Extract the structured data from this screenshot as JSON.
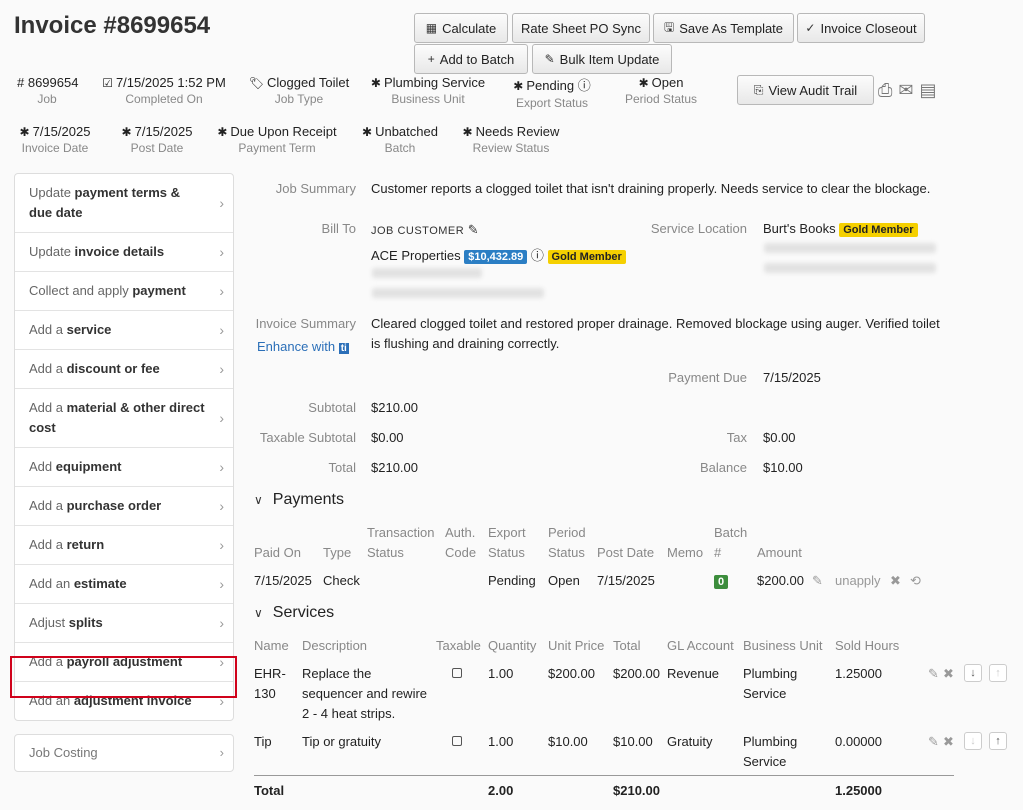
{
  "header": {
    "title": "Invoice #8699654"
  },
  "toolbar": {
    "calculate": "Calculate",
    "rate_sheet": "Rate Sheet PO Sync",
    "save_template": "Save As Template",
    "closeout": "Invoice Closeout",
    "add_batch": "Add to Batch",
    "bulk_update": "Bulk Item Update",
    "audit_trail": "View Audit Trail"
  },
  "meta_row1": [
    {
      "value": "# 8699654",
      "label": "Job"
    },
    {
      "value": "7/15/2025 1:52 PM",
      "label": "Completed On"
    },
    {
      "value": "Clogged Toilet",
      "label": "Job Type"
    },
    {
      "value": "Plumbing Service",
      "label": "Business Unit"
    },
    {
      "value": "Pending",
      "label": "Export Status"
    },
    {
      "value": "Open",
      "label": "Period Status"
    }
  ],
  "meta_row2": [
    {
      "value": "7/15/2025",
      "label": "Invoice Date"
    },
    {
      "value": "7/15/2025",
      "label": "Post Date"
    },
    {
      "value": "Due Upon Receipt",
      "label": "Payment Term"
    },
    {
      "value": "Unbatched",
      "label": "Batch"
    },
    {
      "value": "Needs Review",
      "label": "Review Status"
    }
  ],
  "sidebar": {
    "items": [
      {
        "pre": "Update ",
        "bold": "payment terms & due date"
      },
      {
        "pre": "Update ",
        "bold": "invoice details"
      },
      {
        "pre": "Collect and apply ",
        "bold": "payment"
      },
      {
        "pre": "Add a ",
        "bold": "service"
      },
      {
        "pre": "Add a ",
        "bold": "discount or fee"
      },
      {
        "pre": "Add a ",
        "bold": "material & other direct cost"
      },
      {
        "pre": "Add ",
        "bold": "equipment"
      },
      {
        "pre": "Add a ",
        "bold": "purchase order"
      },
      {
        "pre": "Add a ",
        "bold": "return"
      },
      {
        "pre": "Add an ",
        "bold": "estimate"
      },
      {
        "pre": "Adjust ",
        "bold": "splits"
      },
      {
        "pre": "Add a ",
        "bold": "payroll adjustment"
      },
      {
        "pre": "Add an ",
        "bold": "adjustment invoice"
      }
    ],
    "job_costing": "Job Costing"
  },
  "detail": {
    "job_summary_label": "Job Summary",
    "job_summary": "Customer reports a clogged toilet that isn't draining properly. Needs service to clear the blockage.",
    "bill_to_label": "Bill To",
    "job_customer": "JOB CUSTOMER",
    "customer_name": "ACE Properties",
    "balance_badge": "$10,432.89",
    "gold_member": "Gold Member",
    "service_location_label": "Service Location",
    "location_name": "Burt's Books",
    "invoice_summary_label": "Invoice Summary",
    "enhance_with": "Enhance with",
    "invoice_summary_1": "Cleared clogged toilet and restored proper drainage. Removed blockage using auger. Verified toilet",
    "invoice_summary_2": "is flushing and draining correctly.",
    "payment_due_label": "Payment Due",
    "payment_due": "7/15/2025",
    "subtotal_label": "Subtotal",
    "subtotal": "$210.00",
    "taxable_subtotal_label": "Taxable Subtotal",
    "taxable_subtotal": "$0.00",
    "tax_label": "Tax",
    "tax": "$0.00",
    "total_label": "Total",
    "total": "$210.00",
    "balance_label": "Balance",
    "balance": "$10.00"
  },
  "payments": {
    "title": "Payments",
    "headers": {
      "paid_on": "Paid On",
      "type": "Type",
      "trans1": "Transaction",
      "trans2": "Status",
      "auth1": "Auth.",
      "auth2": "Code",
      "export1": "Export",
      "export2": "Status",
      "period1": "Period",
      "period2": "Status",
      "post_date": "Post Date",
      "memo": "Memo",
      "batch1": "Batch",
      "batch2": "#",
      "amount": "Amount"
    },
    "row": {
      "paid_on": "7/15/2025",
      "type": "Check",
      "export": "Pending",
      "period": "Open",
      "post_date": "7/15/2025",
      "batch": "0",
      "amount": "$200.00",
      "unapply": "unapply"
    }
  },
  "services": {
    "title": "Services",
    "headers": {
      "name": "Name",
      "description": "Description",
      "taxable": "Taxable",
      "quantity": "Quantity",
      "unit_price": "Unit Price",
      "total": "Total",
      "gl": "GL Account",
      "bu": "Business Unit",
      "hours": "Sold Hours"
    },
    "rows": [
      {
        "name1": "EHR-",
        "name2": "130",
        "d1": "Replace the",
        "d2": "sequencer and rewire",
        "d3": "2 - 4 heat strips.",
        "qty": "1.00",
        "unit": "$200.00",
        "total": "$200.00",
        "gl": "Revenue",
        "bu1": "Plumbing",
        "bu2": "Service",
        "hours": "1.25000"
      },
      {
        "name1": "Tip",
        "d1": "Tip or gratuity",
        "qty": "1.00",
        "unit": "$10.00",
        "total": "$10.00",
        "gl": "Gratuity",
        "bu1": "Plumbing",
        "bu2": "Service",
        "hours": "0.00000"
      }
    ],
    "footer": {
      "label": "Total",
      "qty": "2.00",
      "total": "$210.00",
      "hours": "1.25000"
    }
  }
}
